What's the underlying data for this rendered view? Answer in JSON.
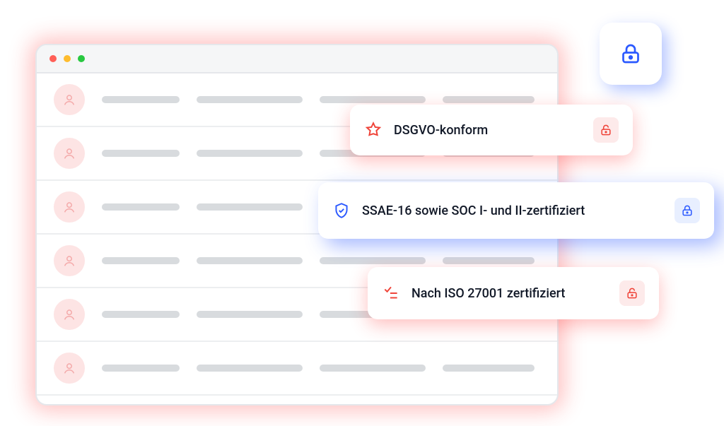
{
  "rows": 6,
  "cards": [
    {
      "icon": "star",
      "label": "DSGVO-konform",
      "lock_color": "red"
    },
    {
      "icon": "shield",
      "label": "SSAE-16 sowie SOC I- und II-zertifiziert",
      "lock_color": "blue"
    },
    {
      "icon": "check",
      "label": "Nach ISO 27001 zertifiziert",
      "lock_color": "red"
    }
  ],
  "colors": {
    "red": "#ef4237",
    "blue": "#2b59ff"
  }
}
